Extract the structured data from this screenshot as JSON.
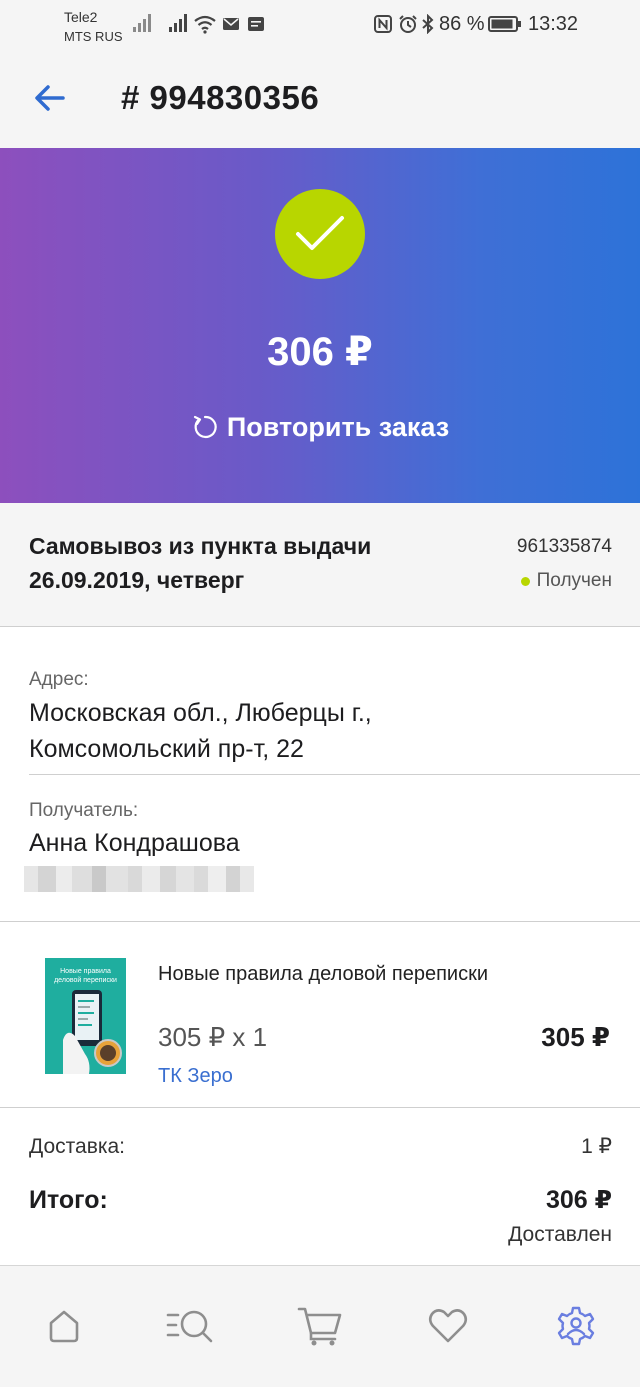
{
  "status_bar": {
    "carrier_1": "Tele2",
    "carrier_2": "MTS RUS",
    "battery": "86 %",
    "time": "13:32"
  },
  "header": {
    "title": "# 994830356",
    "back_icon": "arrow-left-icon"
  },
  "hero": {
    "status_icon": "check-icon",
    "total": "306 ₽",
    "repeat_label": "Повторить заказ",
    "repeat_icon": "repeat-icon",
    "accent_color": "#b8d600",
    "gradient_start": "#8d4fbd",
    "gradient_end": "#2d72d8"
  },
  "delivery": {
    "type_line1": "Самовывоз из пункта выдачи",
    "type_line2": "26.09.2019, четверг",
    "code": "961335874",
    "status": "Получен"
  },
  "address": {
    "label": "Адрес:",
    "line1": "Московская обл., Люберцы г.,",
    "line2": "Комсомольский пр-т, 22"
  },
  "recipient": {
    "label": "Получатель:",
    "name": "Анна Кондрашова"
  },
  "product": {
    "name": "Новые правила деловой переписки",
    "price_qty": "305 ₽ x 1",
    "sum": "305 ₽",
    "seller": "ТК Зеро",
    "cover_title": "Новые правила деловой переписки"
  },
  "totals": {
    "delivery_label": "Доставка:",
    "delivery_value": "1 ₽",
    "total_label": "Итого:",
    "total_value": "306 ₽",
    "total_status": "Доставлен"
  },
  "bottom_nav": {
    "items": [
      "home-icon",
      "catalog-search-icon",
      "cart-icon",
      "favorites-heart-icon",
      "settings-gear-icon"
    ],
    "active_color": "#6a7ee0"
  }
}
